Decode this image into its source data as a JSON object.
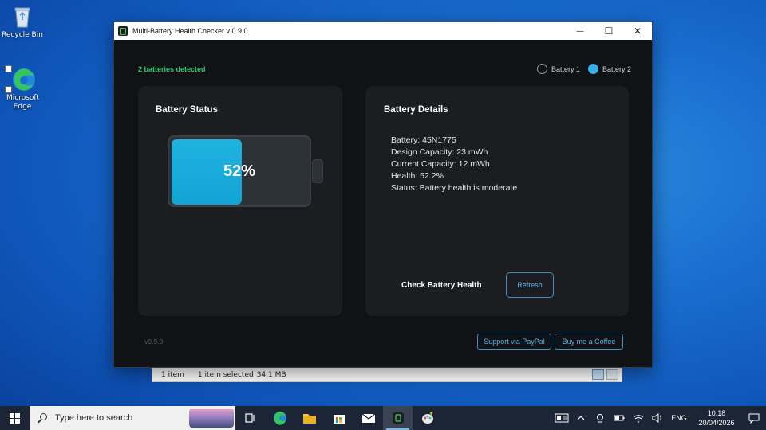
{
  "desktop": {
    "icons": [
      {
        "label": "Recycle Bin"
      },
      {
        "label": "Microsoft Edge"
      }
    ]
  },
  "explorer": {
    "item_count": "1 item",
    "selection": "1 item selected",
    "size": "34,1 MB"
  },
  "window": {
    "title": "Multi-Battery Health Checker v 0.9.0",
    "minimize_glyph": "—",
    "maximize_glyph": "☐",
    "close_glyph": "✕"
  },
  "app": {
    "detected_text": "2 batteries detected",
    "battery_options": [
      {
        "label": "Battery 1",
        "selected": false
      },
      {
        "label": "Battery 2",
        "selected": true
      }
    ],
    "status_card": {
      "title": "Battery Status",
      "percent_text": "52%",
      "level": 0.52
    },
    "details_card": {
      "title": "Battery Details",
      "lines": [
        "Battery: 45N1775",
        "Design Capacity: 23 mWh",
        "Current Capacity: 12 mWh",
        "Health: 52.2%",
        "Status: Battery health is moderate"
      ],
      "check_label": "Check Battery Health",
      "refresh_label": "Refresh"
    },
    "version": "v0.9.0",
    "paypal_label": "Support via PayPal",
    "coffee_label": "Buy me a Coffee"
  },
  "taskbar": {
    "search_placeholder": "Type here to search",
    "lang": "ENG",
    "time": "10.18",
    "date": "20/04/2026"
  },
  "colors": {
    "accent": "#3aaee8",
    "battery_fill": "#1fb3e0",
    "detected_green": "#2ecc71"
  }
}
